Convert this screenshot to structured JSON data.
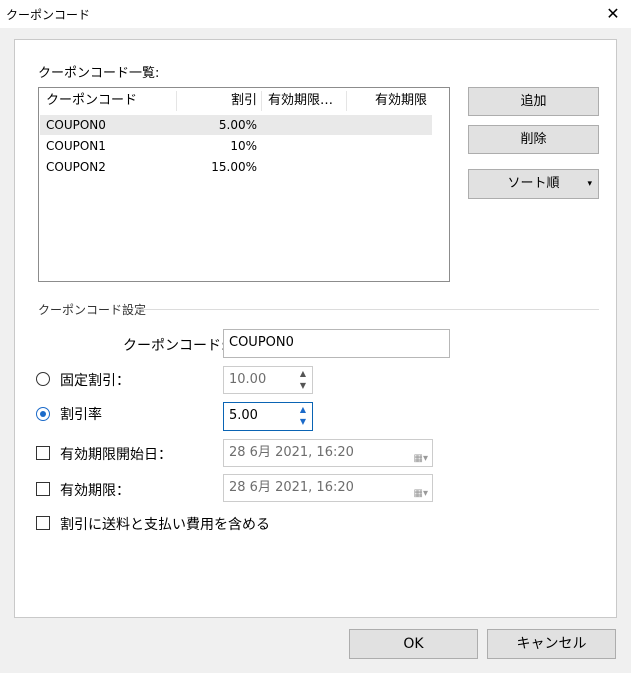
{
  "window": {
    "title": "クーポンコード",
    "close_label": "✕"
  },
  "list": {
    "label": "クーポンコード一覧:",
    "columns": [
      "クーポンコード",
      "割引",
      "有効期限…",
      "有効期限"
    ],
    "rows": [
      {
        "code": "COUPON0",
        "discount": "5.00%"
      },
      {
        "code": "COUPON1",
        "discount": "10%"
      },
      {
        "code": "COUPON2",
        "discount": "15.00%"
      }
    ]
  },
  "buttons": {
    "add": "追加",
    "delete": "削除",
    "sort": "ソート順",
    "sort_arrow": "▾",
    "ok": "OK",
    "cancel": "キャンセル"
  },
  "settings": {
    "section_label": "クーポンコード設定",
    "code_label": "クーポンコード:",
    "code_value": "COUPON0",
    "fixed_label": "固定割引：",
    "fixed_value": "10.00",
    "rate_label": "割引率",
    "rate_value": "5.00",
    "start_label": "有効期限開始日：",
    "start_value": "28  6月  2021, 16:20",
    "expiry_label": "有効期限：",
    "expiry_value": "28  6月  2021, 16:20",
    "include_label": "割引に送料と支払い費用を含める"
  }
}
